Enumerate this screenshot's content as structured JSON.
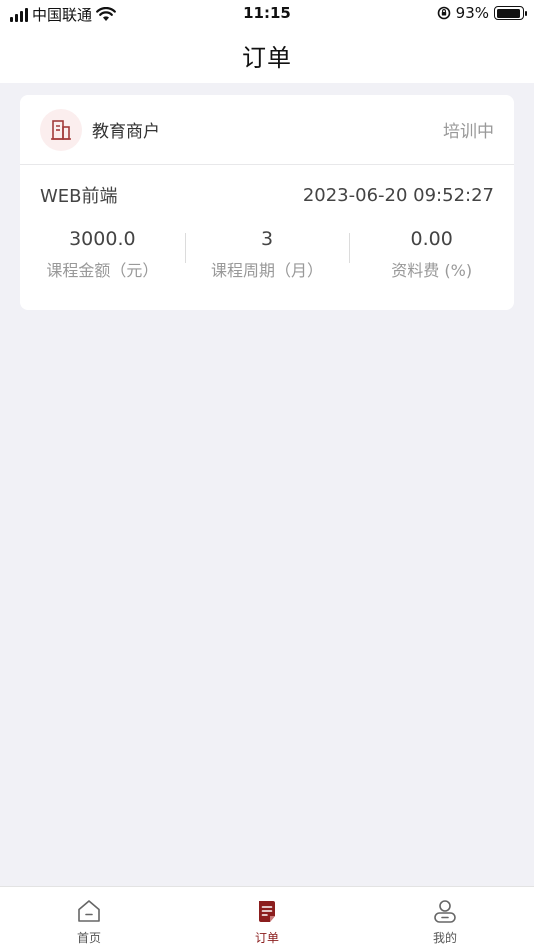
{
  "status_bar": {
    "carrier": "中国联通",
    "time": "11:15",
    "battery_percent": "93%",
    "battery_level": 0.93
  },
  "nav": {
    "title": "订单"
  },
  "order": {
    "merchant_name": "教育商户",
    "status": "培训中",
    "course_name": "WEB前端",
    "datetime": "2023-06-20 09:52:27",
    "stats": [
      {
        "value": "3000.0",
        "label": "课程金额（元）"
      },
      {
        "value": "3",
        "label": "课程周期（月）"
      },
      {
        "value": "0.00",
        "label": "资料费 (%)"
      }
    ]
  },
  "tabs": [
    {
      "label": "首页",
      "icon": "home-icon",
      "active": false
    },
    {
      "label": "订单",
      "icon": "order-icon",
      "active": true
    },
    {
      "label": "我的",
      "icon": "user-icon",
      "active": false
    }
  ],
  "colors": {
    "accent": "#8b1e1e",
    "background": "#f1f1f6",
    "avatar_bg": "#fbeeee"
  }
}
